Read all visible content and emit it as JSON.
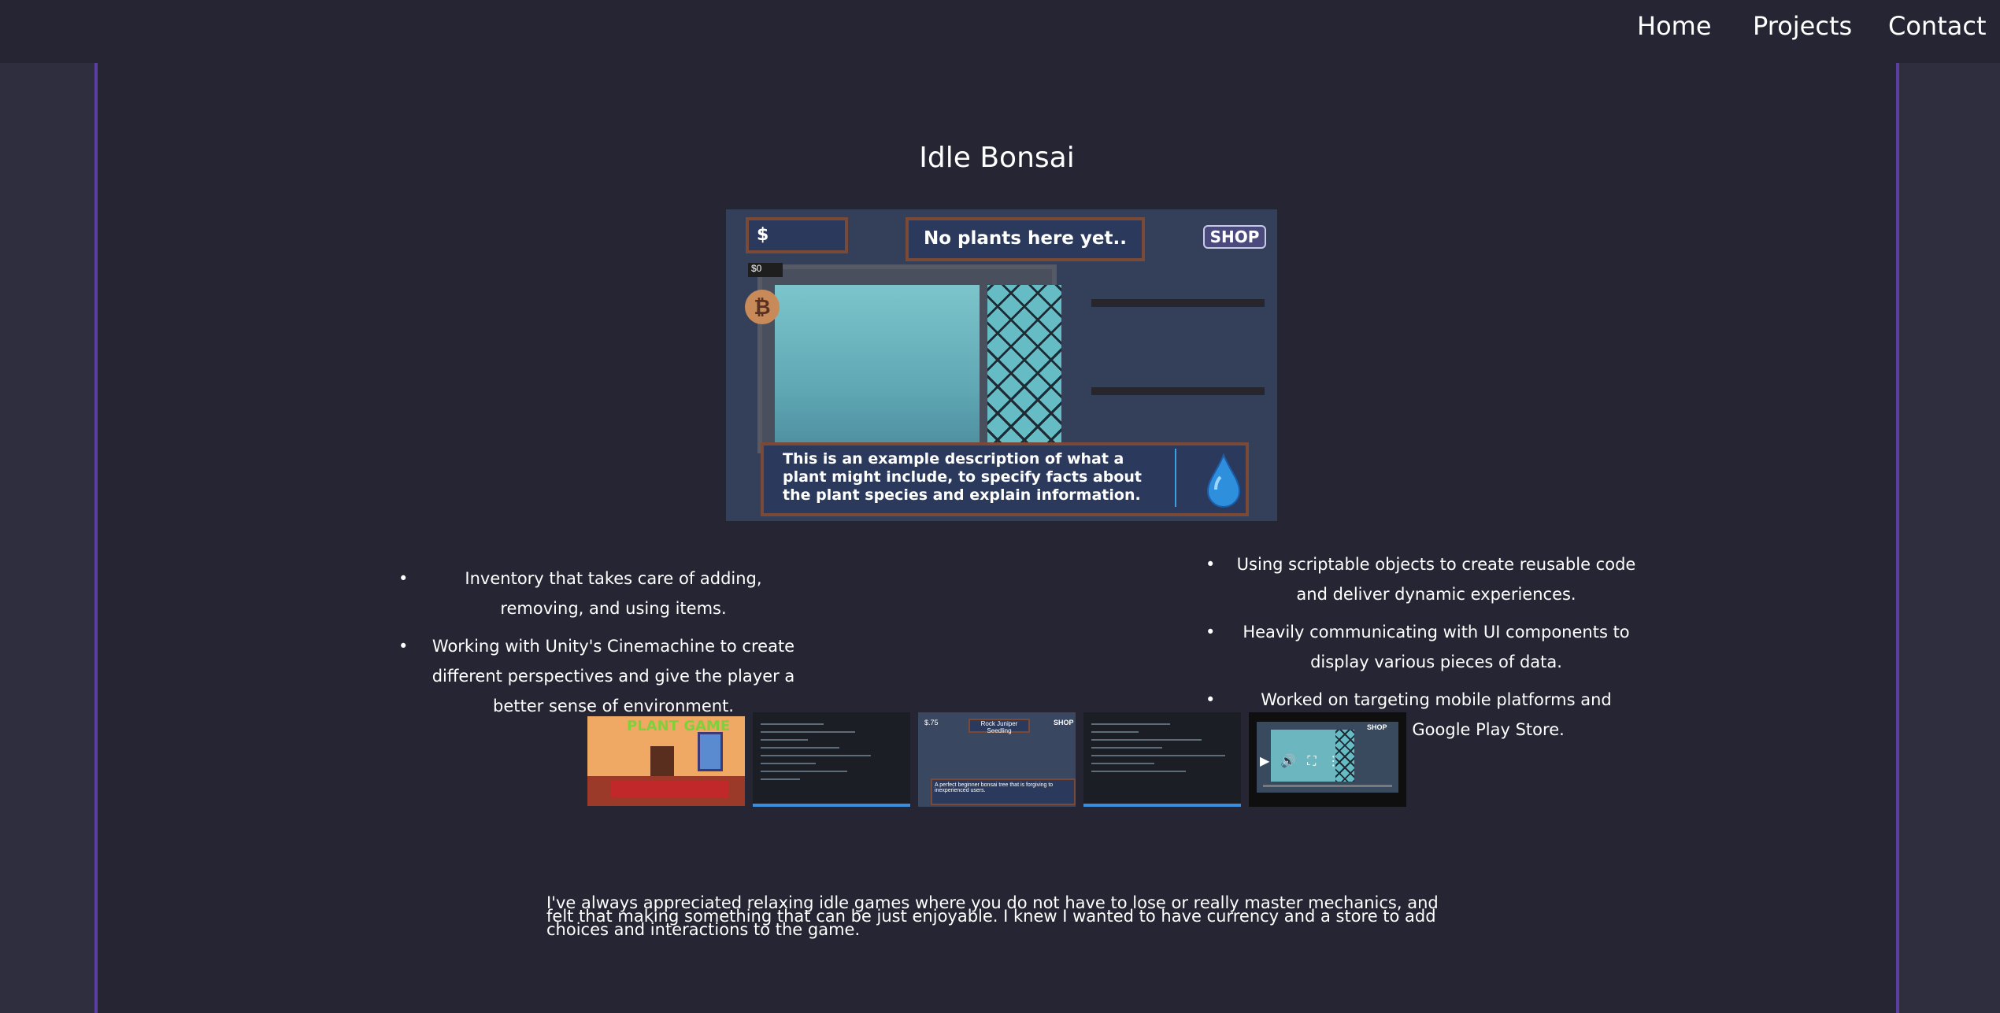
{
  "nav": {
    "links": [
      {
        "label": "Home"
      },
      {
        "label": "Projects"
      },
      {
        "label": "Contact"
      }
    ]
  },
  "project": {
    "title": "Idle Bonsai",
    "screenshot": {
      "money_label": "$",
      "money_value": "$0",
      "header_text": "No plants here yet..",
      "shop_label": "SHOP",
      "description_text": "This is an example description of what a plant might include, to specify facts about the plant species and explain information."
    },
    "features_left": [
      "Inventory that takes care of adding, removing, and using items.",
      "Working with Unity's Cinemachine to create different perspectives and give the player a better sense of environment."
    ],
    "features_right": [
      "Using scriptable objects to create reusable code and deliver dynamic experiences.",
      "Heavily communicating with UI components to display various pieces of data.",
      "Worked on targeting mobile platforms and uploaded to Google Play Store."
    ],
    "thumbnails": {
      "t1_title": "PLANT GAME",
      "t3_header": "Rock Juniper Seedling",
      "t3_shop": "SHOP",
      "t3_money": "$.75",
      "t3_desc": "A perfect beginner bonsai tree that is forgiving to inexperienced users.",
      "t5_shop": "SHOP"
    },
    "description": "I've always appreciated relaxing idle games where you do not have to lose or really master mechanics, and felt that making something that can be just enjoyable. I knew I wanted to have currency and a store to add choices and interactions to the game."
  },
  "colors": {
    "page_bg": "#2f2e3e",
    "panel_bg": "#262533",
    "accent_border": "#5b3fa0"
  }
}
